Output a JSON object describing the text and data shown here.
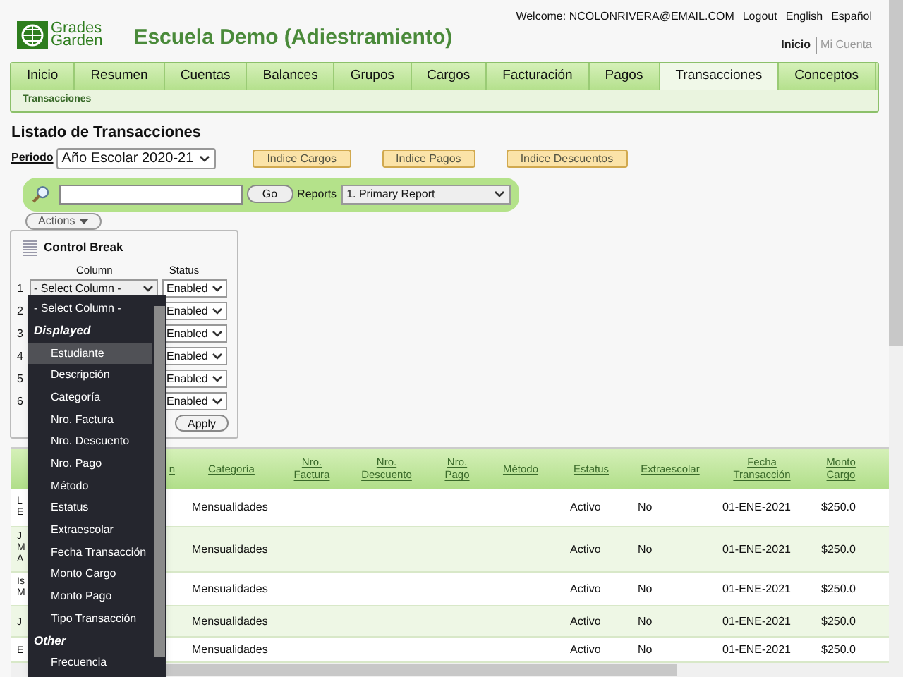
{
  "header": {
    "logo": {
      "line1": "Grades",
      "line2": "Garden"
    },
    "school_name": "Escuela Demo (Adiestramiento)",
    "user_links": [
      "Welcome: NCOLONRIVERA@EMAIL.COM",
      "Logout",
      "English",
      "Español"
    ],
    "account_links": [
      {
        "label": "Inicio",
        "selected": true
      },
      {
        "label": "Mi Cuenta",
        "selected": false
      }
    ]
  },
  "nav": {
    "tabs": [
      {
        "label": "Inicio",
        "selected": false
      },
      {
        "label": "Resumen",
        "selected": false
      },
      {
        "label": "Cuentas",
        "selected": false
      },
      {
        "label": "Balances",
        "selected": false
      },
      {
        "label": "Grupos",
        "selected": false
      },
      {
        "label": "Cargos",
        "selected": false
      },
      {
        "label": "Facturación",
        "selected": false
      },
      {
        "label": "Pagos",
        "selected": false
      },
      {
        "label": "Transacciones",
        "selected": true
      },
      {
        "label": "Conceptos",
        "selected": false
      }
    ],
    "subnav": "Transacciones"
  },
  "page_title": "Listado de Transacciones",
  "period": {
    "label": "Periodo",
    "value": "Año Escolar 2020-21"
  },
  "index_buttons": [
    "Indice Cargos",
    "Indice Pagos",
    "Indice Descuentos"
  ],
  "search": {
    "button": "Go",
    "reports_label": "Reports",
    "report_value": "1. Primary Report"
  },
  "actions_button": "Actions",
  "control_break": {
    "title": "Control Break",
    "column_header": "Column",
    "status_header": "Status",
    "apply": "Apply",
    "rows": [
      {
        "number": "1",
        "column": "- Select Column -",
        "status": "Enabled"
      },
      {
        "number": "2",
        "status": "Enabled"
      },
      {
        "number": "3",
        "status": "Enabled"
      },
      {
        "number": "4",
        "status": "Enabled"
      },
      {
        "number": "5",
        "status": "Enabled"
      },
      {
        "number": "6",
        "status": "Enabled"
      }
    ]
  },
  "dropdown": {
    "options": [
      {
        "kind": "option",
        "label": "- Select Column -",
        "selected": false
      },
      {
        "kind": "group",
        "label": "Displayed"
      },
      {
        "kind": "option",
        "label": "Estudiante",
        "selected": true
      },
      {
        "kind": "option",
        "label": "Descripción",
        "selected": false
      },
      {
        "kind": "option",
        "label": "Categoría",
        "selected": false
      },
      {
        "kind": "option",
        "label": "Nro. Factura",
        "selected": false
      },
      {
        "kind": "option",
        "label": "Nro. Descuento",
        "selected": false
      },
      {
        "kind": "option",
        "label": "Nro. Pago",
        "selected": false
      },
      {
        "kind": "option",
        "label": "Método",
        "selected": false
      },
      {
        "kind": "option",
        "label": "Estatus",
        "selected": false
      },
      {
        "kind": "option",
        "label": "Extraescolar",
        "selected": false
      },
      {
        "kind": "option",
        "label": "Fecha Transacción",
        "selected": false
      },
      {
        "kind": "option",
        "label": "Monto Cargo",
        "selected": false
      },
      {
        "kind": "option",
        "label": "Monto Pago",
        "selected": false
      },
      {
        "kind": "option",
        "label": "Tipo Transacción",
        "selected": false
      },
      {
        "kind": "group",
        "label": "Other"
      },
      {
        "kind": "option",
        "label": "Frecuencia",
        "selected": false
      }
    ]
  },
  "table": {
    "columns": [
      [
        "n"
      ],
      [
        "Categoría"
      ],
      [
        "Nro.",
        "Factura"
      ],
      [
        "Nro.",
        "Descuento"
      ],
      [
        "Nro.",
        "Pago"
      ],
      [
        "Método"
      ],
      [
        "Estatus"
      ],
      [
        "Extraescolar"
      ],
      [
        "Fecha",
        "Transacción"
      ],
      [
        "Monto",
        "Cargo"
      ]
    ],
    "rows": [
      {
        "column_1": [
          "L",
          "E"
        ],
        "category": "Mensualidades",
        "status": "Activo",
        "extracurricular": "No",
        "date": "01-ENE-2021",
        "amount": "$250.0"
      },
      {
        "column_1": [
          "J",
          "M",
          "A"
        ],
        "category": "Mensualidades",
        "status": "Activo",
        "extracurricular": "No",
        "date": "01-ENE-2021",
        "amount": "$250.0"
      },
      {
        "column_1": [
          "Is",
          "M"
        ],
        "category": "Mensualidades",
        "status": "Activo",
        "extracurricular": "No",
        "date": "01-ENE-2021",
        "amount": "$250.0"
      },
      {
        "column_1": [
          "J"
        ],
        "category": "Mensualidades",
        "status": "Activo",
        "extracurricular": "No",
        "date": "01-ENE-2021",
        "amount": "$250.0"
      },
      {
        "column_1": [
          "E"
        ],
        "category": "Mensualidades",
        "status": "Activo",
        "extracurricular": "No",
        "date": "01-ENE-2021",
        "amount": "$250.0"
      }
    ]
  }
}
